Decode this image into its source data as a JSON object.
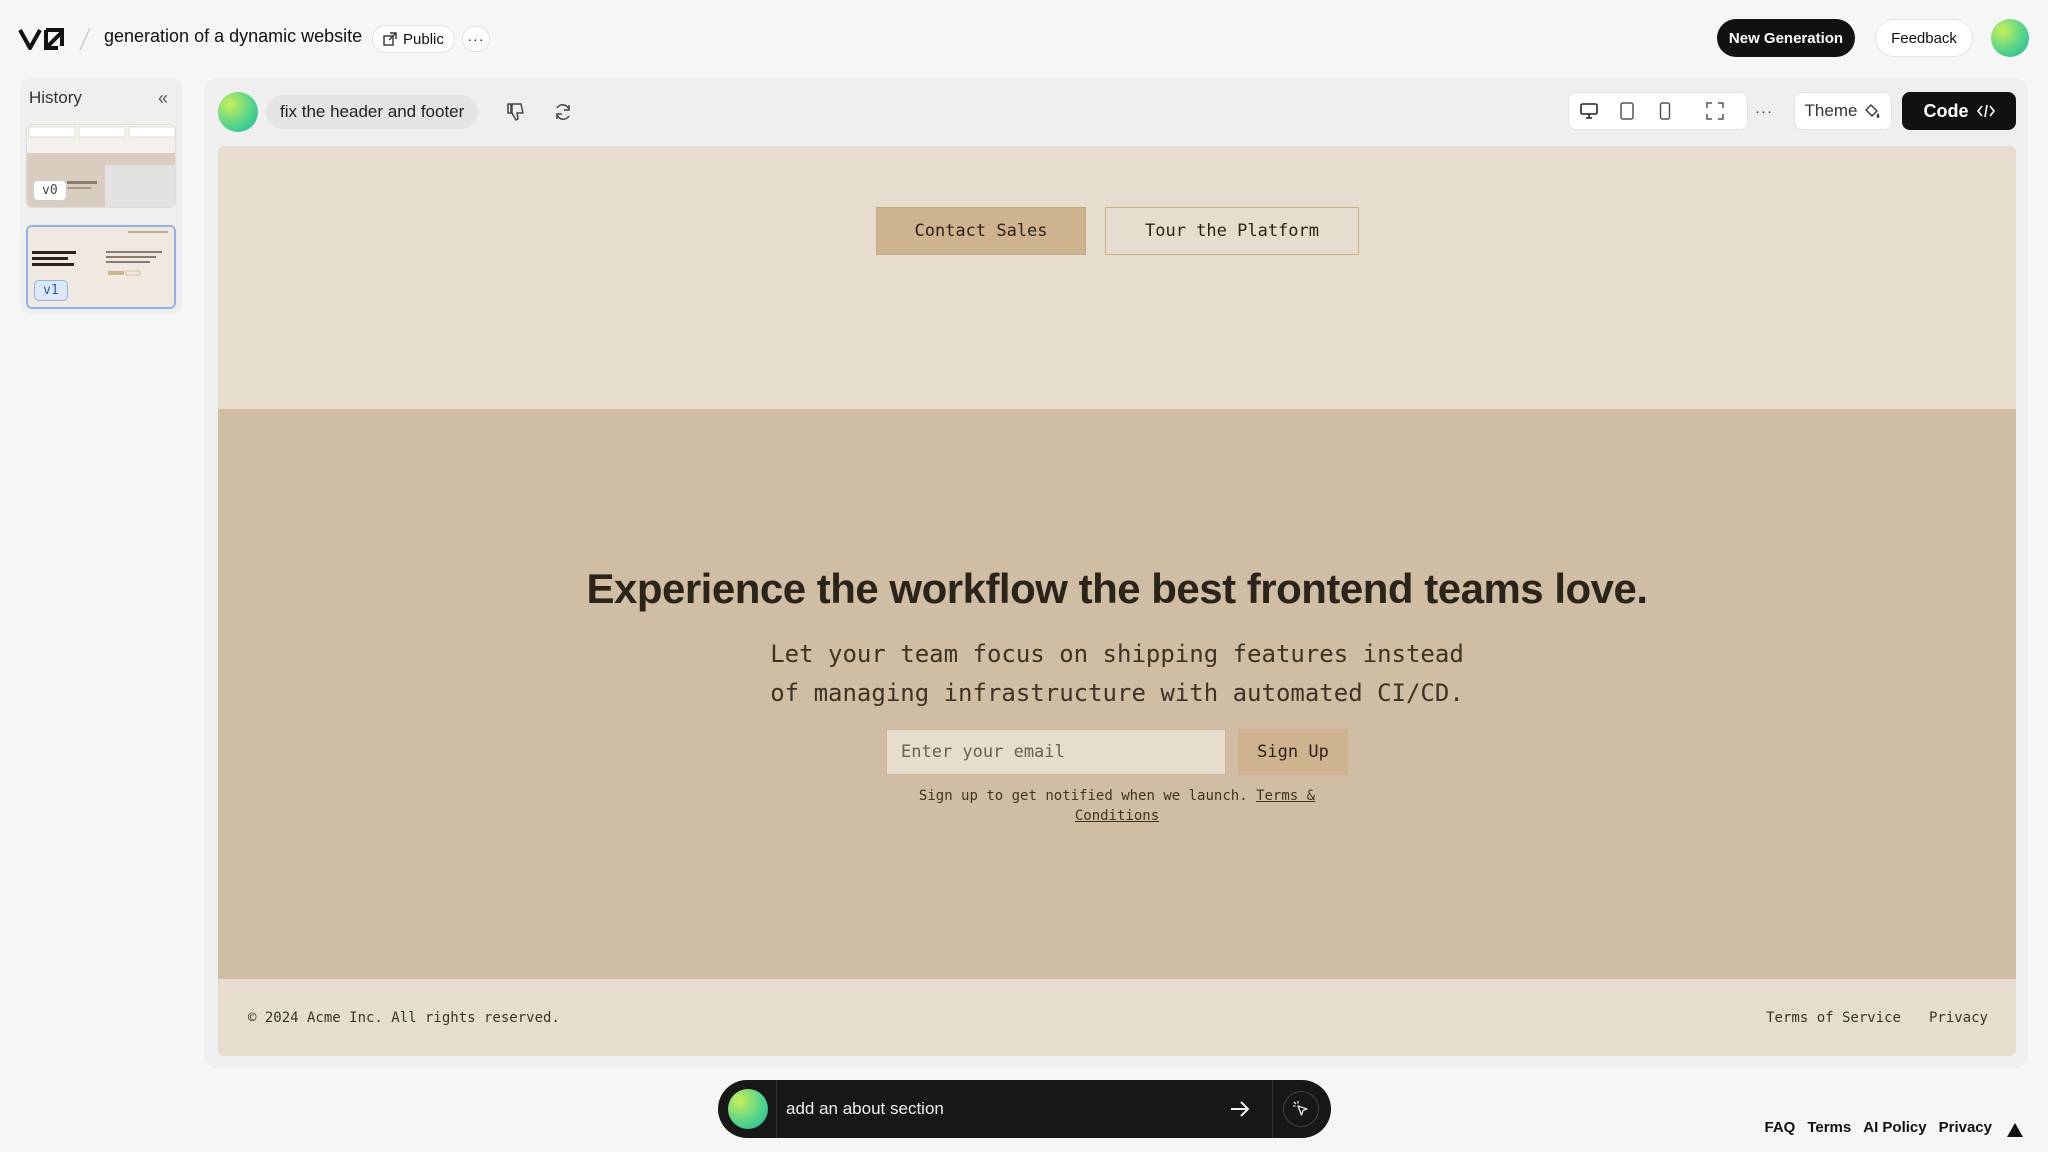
{
  "header": {
    "project_title": "generation of a dynamic website",
    "visibility_label": "Public",
    "more_label": "···",
    "new_generation_label": "New Generation",
    "feedback_label": "Feedback"
  },
  "history": {
    "title": "History",
    "collapse_icon": "chevrons-left-icon",
    "versions": [
      {
        "label": "v0",
        "selected": false
      },
      {
        "label": "v1",
        "selected": true
      }
    ]
  },
  "toolbar": {
    "prompt": "fix the header and footer",
    "theme_label": "Theme",
    "code_label": "Code",
    "more_label": "···",
    "devices": [
      "desktop",
      "tablet",
      "mobile",
      "fullscreen"
    ]
  },
  "preview": {
    "buttons": {
      "contact_sales": "Contact Sales",
      "tour_platform": "Tour the Platform"
    },
    "cta": {
      "title": "Experience the workflow the best frontend teams love.",
      "subtitle": "Let your team focus on shipping features instead of managing infrastructure with automated CI/CD.",
      "email_placeholder": "Enter your email",
      "signup_label": "Sign Up",
      "notify_text": "Sign up to get notified when we launch.",
      "terms_link": "Terms & Conditions"
    },
    "footer": {
      "copyright": "© 2024 Acme Inc. All rights reserved.",
      "links": [
        "Terms of Service",
        "Privacy"
      ]
    },
    "colors": {
      "hero_bg": "#e6ddce",
      "cta_bg": "#cfbea4",
      "accent": "#cdb38e"
    }
  },
  "chat": {
    "input_value": "add an about section"
  },
  "bottom_links": [
    "FAQ",
    "Terms",
    "AI Policy",
    "Privacy"
  ]
}
